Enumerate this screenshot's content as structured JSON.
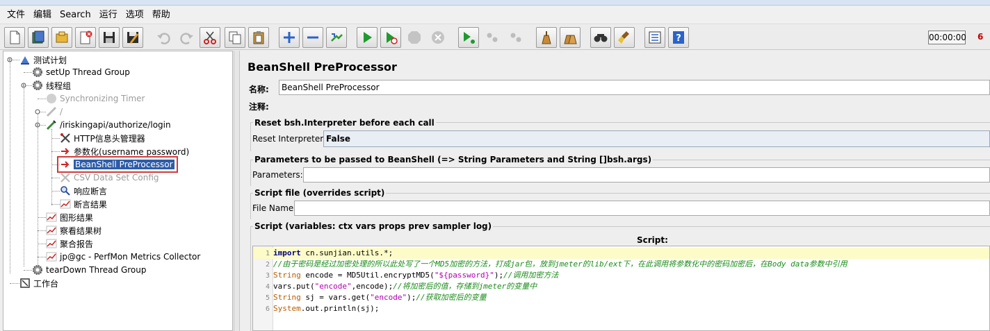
{
  "menu": [
    "文件",
    "编辑",
    "Search",
    "运行",
    "选项",
    "帮助"
  ],
  "toolbar": {
    "timer": "00:00:00",
    "active_threads": "6",
    "buttons": [
      "new-icon",
      "templates-icon",
      "open-icon",
      "close-icon",
      "save-icon",
      "save-as-icon",
      "undo-icon",
      "redo-icon",
      "cut-icon",
      "copy-icon",
      "paste-icon",
      "expand-icon",
      "collapse-icon",
      "toggle-icon",
      "start-icon",
      "start-no-pause-icon",
      "stop-icon",
      "shutdown-icon",
      "remote-start-icon",
      "remote-stop-icon",
      "remote-shutdown-icon",
      "clear-icon",
      "clear-all-icon",
      "search-icon",
      "reset-search-icon",
      "function-helper-icon",
      "help-icon"
    ]
  },
  "tree": {
    "items": [
      {
        "label": "测试计划",
        "icon": "test-plan-icon"
      },
      {
        "label": "setUp Thread Group",
        "icon": "gear-icon"
      },
      {
        "label": "线程组",
        "icon": "gear-icon"
      },
      {
        "label": "Synchronizing Timer",
        "icon": "timer-icon",
        "disabled": true
      },
      {
        "label": "/",
        "icon": "sampler-icon",
        "disabled": true
      },
      {
        "label": "/iriskingapi/authorize/login",
        "icon": "sampler-icon"
      },
      {
        "label": "HTTP信息头管理器",
        "icon": "tools-icon"
      },
      {
        "label": "参数化(username password)",
        "icon": "preprocessor-icon"
      },
      {
        "label": "BeanShell PreProcessor",
        "icon": "preprocessor-icon",
        "selected": true
      },
      {
        "label": "CSV Data Set Config",
        "icon": "config-icon",
        "disabled": true
      },
      {
        "label": "响应断言",
        "icon": "magnifier-icon"
      },
      {
        "label": "断言结果",
        "icon": "graph-icon"
      },
      {
        "label": "图形结果",
        "icon": "graph-icon"
      },
      {
        "label": "察看结果树",
        "icon": "graph-icon"
      },
      {
        "label": "聚合报告",
        "icon": "graph-icon"
      },
      {
        "label": "jp@gc - PerfMon Metrics Collector",
        "icon": "graph-icon"
      },
      {
        "label": "tearDown Thread Group",
        "icon": "gear-icon"
      },
      {
        "label": "工作台",
        "icon": "workbench-icon"
      }
    ]
  },
  "panel": {
    "title": "BeanShell PreProcessor",
    "name_label": "名称:",
    "name_value": "BeanShell PreProcessor",
    "comments_label": "注释:",
    "comments_value": "",
    "reset_group_title": "Reset bsh.Interpreter before each call",
    "reset_label": "Reset Interpreter:",
    "reset_value": "False",
    "params_group_title": "Parameters to be passed to BeanShell (=> String Parameters and String []bsh.args)",
    "params_label": "Parameters:",
    "params_value": "",
    "file_group_title": "Script file (overrides script)",
    "file_label": "File Name:",
    "file_value": "",
    "script_group_title": "Script (variables: ctx vars props prev sampler log)",
    "script_caption": "Script:",
    "script_lines": [
      "import cn.sunjian.utils.*;",
      "//由于密码是经过加密处理的所以此处写了一个MD5加密的方法，打成jar包，放到jmeter的lib/ext下，在此调用将参数化中的密码加密后，在Body data参数中引用",
      "String encode = MD5Util.encryptMD5(\"${password}\");//调用加密方法",
      "vars.put(\"encode\",encode);//将加密后的值，存储到jmeter的变量中",
      "String sj = vars.get(\"encode\");//获取加密后的变量",
      "System.out.println(sj);"
    ]
  }
}
